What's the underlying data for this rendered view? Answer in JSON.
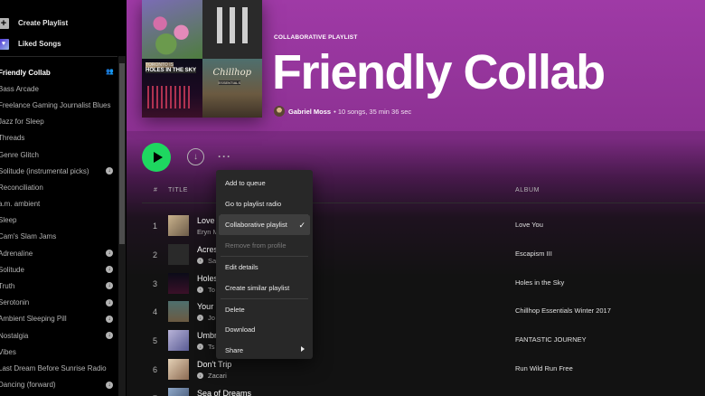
{
  "sidebar": {
    "create_playlist": "Create Playlist",
    "liked_songs": "Liked Songs",
    "playlists": [
      {
        "name": "Friendly Collab",
        "active": true,
        "badge": "collab"
      },
      {
        "name": "Bass Arcade",
        "badge": ""
      },
      {
        "name": "Freelance Gaming Journalist Blues",
        "badge": ""
      },
      {
        "name": "Jazz for Sleep",
        "badge": ""
      },
      {
        "name": "Threads",
        "badge": ""
      },
      {
        "name": "Genre Glitch",
        "badge": ""
      },
      {
        "name": "Solitude (instrumental picks)",
        "badge": "download"
      },
      {
        "name": "Reconciliation",
        "badge": ""
      },
      {
        "name": "a.m. ambient",
        "badge": ""
      },
      {
        "name": "Sleep",
        "badge": ""
      },
      {
        "name": "Cam's Slam Jams",
        "badge": ""
      },
      {
        "name": "Adrenaline",
        "badge": "download"
      },
      {
        "name": "Solitude",
        "badge": "download"
      },
      {
        "name": "Truth",
        "badge": "download"
      },
      {
        "name": "Serotonin",
        "badge": "download"
      },
      {
        "name": "Ambient Sleeping Pill",
        "badge": "download"
      },
      {
        "name": "Nostalgia",
        "badge": "download"
      },
      {
        "name": "Vibes",
        "badge": ""
      },
      {
        "name": "Last Dream Before Sunrise Radio",
        "badge": ""
      },
      {
        "name": "Dancing (forward)",
        "badge": "download"
      }
    ]
  },
  "header": {
    "type_label": "COLLABORATIVE PLAYLIST",
    "title": "Friendly Collab",
    "owner": "Gabriel Moss",
    "meta": "• 10 songs, 35 min 36 sec",
    "cover_text_1": "TORONTO IS",
    "cover_text_2": "HOLES IN THE SKY",
    "cover_text_3": "Chillhop",
    "cover_text_4": "ESSENTIALS"
  },
  "table": {
    "col_num": "#",
    "col_title": "TITLE",
    "col_album": "ALBUM",
    "rows": [
      {
        "num": "1",
        "title": "Love",
        "artist": "Eryn M",
        "downloaded": false,
        "album": "Love You"
      },
      {
        "num": "2",
        "title": "Acres",
        "artist": "Sa",
        "downloaded": true,
        "album": "Escapism III"
      },
      {
        "num": "3",
        "title": "Holes",
        "artist": "To",
        "downloaded": true,
        "album": "Holes in the Sky"
      },
      {
        "num": "4",
        "title": "Your",
        "artist": "Jo",
        "downloaded": true,
        "album": "Chillhop Essentials Winter 2017"
      },
      {
        "num": "5",
        "title": "Umbr",
        "artist": "Ts",
        "downloaded": true,
        "album": "FANTASTIC JOURNEY"
      },
      {
        "num": "6",
        "title": "Don't Trip",
        "artist": "Zacari",
        "downloaded": true,
        "album": "Run Wild Run Free"
      },
      {
        "num": "7",
        "title": "Sea of Dreams",
        "artist": "",
        "downloaded": false,
        "album": ""
      }
    ]
  },
  "context_menu": {
    "items": [
      {
        "label": "Add to queue",
        "state": ""
      },
      {
        "label": "Go to playlist radio",
        "state": ""
      },
      {
        "label": "Collaborative playlist",
        "state": "checked"
      },
      {
        "label": "Remove from profile",
        "state": "disabled"
      },
      {
        "label": "Edit details",
        "state": ""
      },
      {
        "label": "Create similar playlist",
        "state": ""
      },
      {
        "label": "Delete",
        "state": ""
      },
      {
        "label": "Download",
        "state": ""
      },
      {
        "label": "Share",
        "state": "submenu"
      }
    ]
  },
  "colors": {
    "accent": "#1ed760",
    "header_top": "#9f3aa6",
    "menu_bg": "#282828"
  }
}
